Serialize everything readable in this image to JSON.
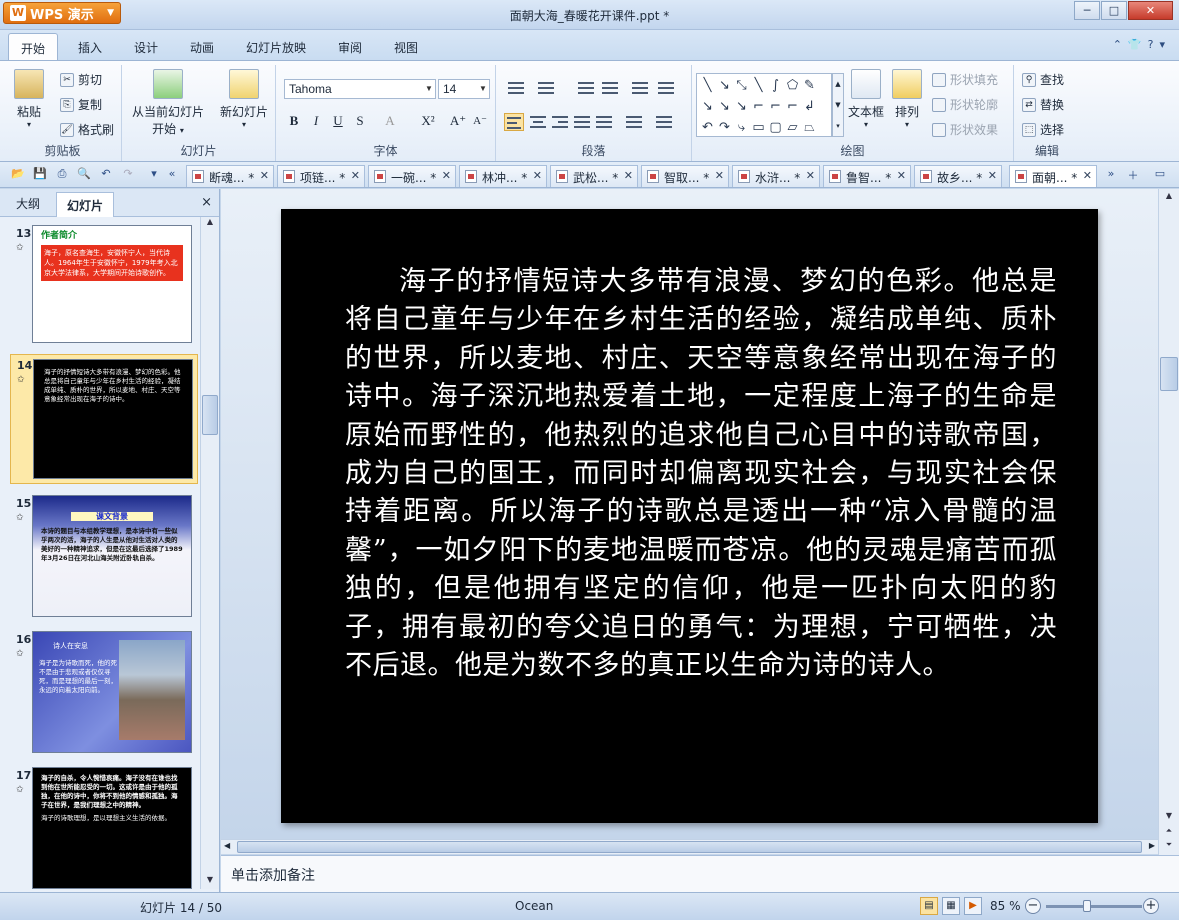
{
  "app": {
    "name": "WPS 演示",
    "title": "面朝大海_春暖花开课件.ppt *",
    "window_buttons": [
      "─",
      "□",
      "✕"
    ]
  },
  "menu": {
    "tabs": [
      "开始",
      "插入",
      "设计",
      "动画",
      "幻灯片放映",
      "审阅",
      "视图"
    ],
    "active": "开始"
  },
  "ribbon": {
    "clipboard": {
      "paste": "粘贴",
      "cut": "剪切",
      "copy": "复制",
      "format_painter": "格式刷",
      "label": "剪贴板"
    },
    "slides": {
      "play_from_current": "从当前幻灯片",
      "play_start": "开始",
      "new_slide": "新幻灯片",
      "label": "幻灯片"
    },
    "font": {
      "name": "Tahoma",
      "size": "14",
      "label": "字体",
      "bold": "B",
      "italic": "I",
      "underline": "U",
      "strike": "S"
    },
    "paragraph": {
      "label": "段落"
    },
    "drawing": {
      "textbox": "文本框",
      "arrange": "排列",
      "shape_fill": "形状填充",
      "shape_outline": "形状轮廓",
      "shape_effect": "形状效果",
      "label": "绘图"
    },
    "editing": {
      "find": "查找",
      "replace": "替换",
      "select": "选择",
      "label": "编辑"
    }
  },
  "doc_tabs": [
    "断魂... *",
    "项链... *",
    "一碗... *",
    "林冲... *",
    "武松... *",
    "智取... *",
    "水浒... *",
    "鲁智... *",
    "故乡... *",
    "面朝... *"
  ],
  "panel": {
    "outline_tab": "大纲",
    "slides_tab": "幻灯片",
    "close": "×"
  },
  "thumbnails": [
    {
      "num": "13",
      "title": "作者简介",
      "text": "海子，原名查海生，安徽怀宁人，当代诗人。1964年生于安徽怀宁，1979年考入北京大学法律系，大学期间开始诗歌创作。"
    },
    {
      "num": "14",
      "text": "海子的抒情短诗大多带有浪漫、梦幻的色彩。他总是将自己童年与少年在乡村生活的经验，凝结成单纯、质朴的世界，所以麦地、村庄、天空等意象经常出现在海子的诗中。"
    },
    {
      "num": "15",
      "title": "课文背景",
      "text": "本诗的题目与本组教学理想，是本诗中有一些似乎两次的活，海子的人生是从他对生活对人类的美好的一种精神追求，但是在这最后选择了1989年3月26日在河北山海关附近卧轨自杀。"
    },
    {
      "num": "16",
      "title": "诗人在安息",
      "text": "海子是为诗歌而死，他的死不是由于悲观或者仅仅寻死，而是理想的最后一刻，永远的向着太阳向前。"
    },
    {
      "num": "17",
      "text": "海子的自杀，令人惋惜哀痛。海子没有在谁也找到他在世所能忍受的一切。这或许是由于他的孤独，在他的诗中，你将不到他的情感和孤独。海子在世界，是我们理想之中的精神。",
      "sub": "海子的诗歌理想，是以理想主义生活的依据。"
    }
  ],
  "slide": {
    "body": "海子的抒情短诗大多带有浪漫、梦幻的色彩。他总是将自己童年与少年在乡村生活的经验，凝结成单纯、质朴的世界，所以麦地、村庄、天空等意象经常出现在海子的诗中。海子深沉地热爱着土地，一定程度上海子的生命是原始而野性的，他热烈的追求他自己心目中的诗歌帝国，成为自己的国王，而同时却偏离现实社会，与现实社会保持着距离。所以海子的诗歌总是透出一种“凉入骨髓的温馨”，一如夕阳下的麦地温暖而苍凉。他的灵魂是痛苦而孤独的，但是他拥有坚定的信仰，他是一匹扑向太阳的豹子，拥有最初的夸父追日的勇气：为理想，宁可牺牲，决不后退。他是为数不多的真正以生命为诗的诗人。"
  },
  "notes": {
    "placeholder": "单击添加备注"
  },
  "status": {
    "slide_counter": "幻灯片 14 / 50",
    "theme": "Ocean",
    "zoom": "85 %",
    "zoom_level": 0.42
  }
}
